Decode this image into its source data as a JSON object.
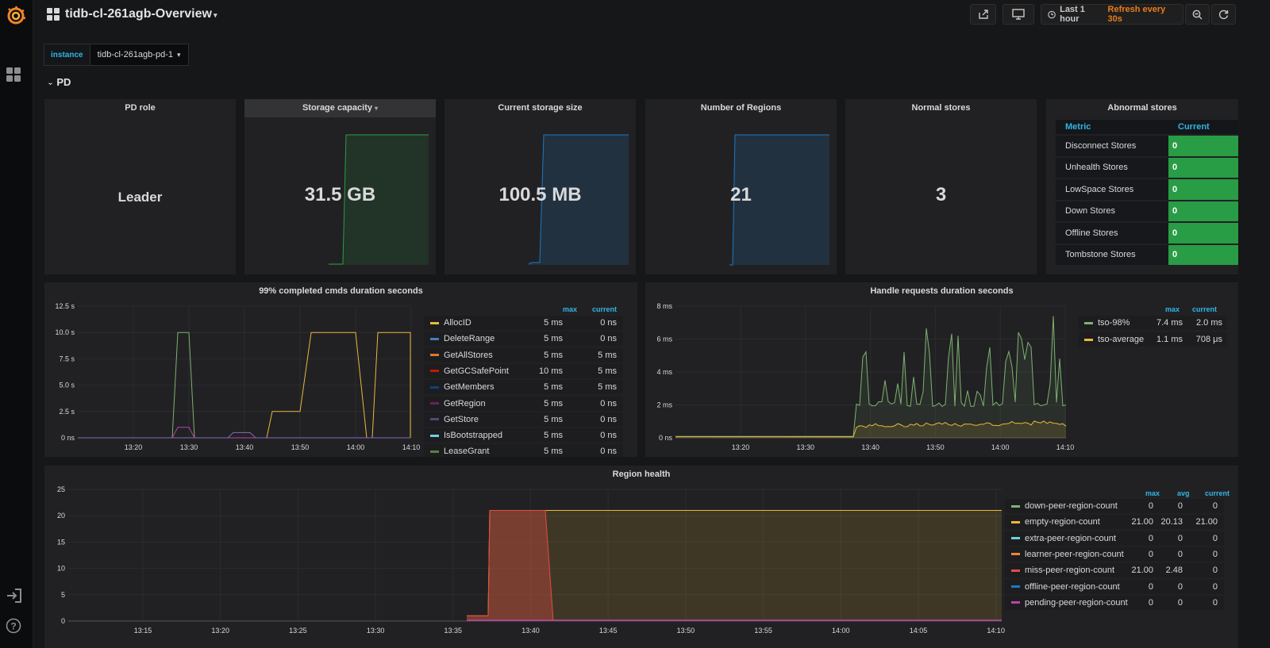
{
  "dashboard": {
    "title": "tidb-cl-261agb-Overview"
  },
  "toolbar": {
    "time_range": "Last 1 hour",
    "refresh": "Refresh every 30s"
  },
  "variable": {
    "label": "instance",
    "value": "tidb-cl-261agb-pd-1"
  },
  "row": {
    "title": "PD"
  },
  "stats": {
    "pd_role": {
      "title": "PD role",
      "value": "Leader"
    },
    "storage_capacity": {
      "title": "Storage capacity",
      "value": "31.5 GB",
      "color": "#299c46"
    },
    "current_storage": {
      "title": "Current storage size",
      "value": "100.5 MB",
      "color": "#1f78c1"
    },
    "regions": {
      "title": "Number of Regions",
      "value": "21",
      "color": "#1f78c1"
    },
    "normal_stores": {
      "title": "Normal stores",
      "value": "3"
    }
  },
  "abnormal": {
    "title": "Abnormal stores",
    "col_metric": "Metric",
    "col_current": "Current",
    "rows": [
      {
        "metric": "Disconnect Stores",
        "current": "0"
      },
      {
        "metric": "Unhealth Stores",
        "current": "0"
      },
      {
        "metric": "LowSpace Stores",
        "current": "0"
      },
      {
        "metric": "Down Stores",
        "current": "0"
      },
      {
        "metric": "Offline Stores",
        "current": "0"
      },
      {
        "metric": "Tombstone Stores",
        "current": "0"
      }
    ]
  },
  "cmds": {
    "title": "99% completed cmds duration seconds",
    "legend_max": "max",
    "legend_current": "current",
    "legend": [
      {
        "name": "AllocID",
        "max": "5 ms",
        "current": "0 ns",
        "color": "#eab839"
      },
      {
        "name": "DeleteRange",
        "max": "5 ms",
        "current": "0 ns",
        "color": "#447ebc"
      },
      {
        "name": "GetAllStores",
        "max": "5 ms",
        "current": "5 ms",
        "color": "#e0752d"
      },
      {
        "name": "GetGCSafePoint",
        "max": "10 ms",
        "current": "5 ms",
        "color": "#bf1b00"
      },
      {
        "name": "GetMembers",
        "max": "5 ms",
        "current": "5 ms",
        "color": "#0a437c"
      },
      {
        "name": "GetRegion",
        "max": "5 ms",
        "current": "0 ns",
        "color": "#6d1f62"
      },
      {
        "name": "GetStore",
        "max": "5 ms",
        "current": "0 ns",
        "color": "#584477"
      },
      {
        "name": "IsBootstrapped",
        "max": "5 ms",
        "current": "0 ns",
        "color": "#6ed0e0"
      },
      {
        "name": "LeaseGrant",
        "max": "5 ms",
        "current": "0 ns",
        "color": "#508642"
      }
    ]
  },
  "handle": {
    "title": "Handle requests duration seconds",
    "legend_max": "max",
    "legend_current": "current",
    "legend": [
      {
        "name": "tso-98%",
        "max": "7.4 ms",
        "current": "2.0 ms",
        "color": "#7eb26d"
      },
      {
        "name": "tso-average",
        "max": "1.1 ms",
        "current": "708 μs",
        "color": "#eab839"
      }
    ]
  },
  "region": {
    "title": "Region health",
    "legend_max": "max",
    "legend_avg": "avg",
    "legend_current": "current",
    "legend": [
      {
        "name": "down-peer-region-count",
        "max": "0",
        "avg": "0",
        "current": "0",
        "color": "#7eb26d"
      },
      {
        "name": "empty-region-count",
        "max": "21.00",
        "avg": "20.13",
        "current": "21.00",
        "color": "#eab839"
      },
      {
        "name": "extra-peer-region-count",
        "max": "0",
        "avg": "0",
        "current": "0",
        "color": "#6ed0e0"
      },
      {
        "name": "learner-peer-region-count",
        "max": "0",
        "avg": "0",
        "current": "0",
        "color": "#ef843c"
      },
      {
        "name": "miss-peer-region-count",
        "max": "21.00",
        "avg": "2.48",
        "current": "0",
        "color": "#e24d42"
      },
      {
        "name": "offline-peer-region-count",
        "max": "0",
        "avg": "0",
        "current": "0",
        "color": "#1f78c1"
      },
      {
        "name": "pending-peer-region-count",
        "max": "0",
        "avg": "0",
        "current": "0",
        "color": "#ba43a9"
      }
    ]
  },
  "chart_data": [
    {
      "type": "line",
      "title": "99% completed cmds duration seconds",
      "ylim": [
        0,
        12.5
      ],
      "yticks": [
        "0 ns",
        "2.5 s",
        "5.0 s",
        "7.5 s",
        "10.0 s",
        "12.5 s"
      ],
      "xticks": [
        "13:20",
        "13:30",
        "13:40",
        "13:50",
        "14:00",
        "14:10"
      ],
      "x_minutes": [
        -8,
        13.2
      ],
      "series": [
        {
          "name": "AllocID",
          "color": "#eab839",
          "points": [
            [
              -8,
              0
            ],
            [
              13.44,
              0
            ],
            [
              13.45,
              2.5
            ],
            [
              13.5,
              2.5
            ],
            [
              13.52,
              10
            ],
            [
              14.0,
              10
            ],
            [
              14.02,
              0
            ],
            [
              14.03,
              0
            ],
            [
              14.04,
              10
            ],
            [
              14.15,
              10
            ],
            [
              14.16,
              0
            ],
            [
              14.18,
              0
            ],
            [
              14.19,
              10
            ],
            [
              14.34,
              10
            ],
            [
              14.35,
              0
            ],
            [
              14.36,
              10
            ],
            [
              14.55,
              10
            ]
          ]
        },
        {
          "name": "LeaseGrant",
          "color": "#7eb26d",
          "points": [
            [
              -8,
              0
            ],
            [
              13.27,
              0
            ],
            [
              13.28,
              10
            ],
            [
              13.3,
              10
            ],
            [
              13.31,
              0
            ],
            [
              14.55,
              0
            ]
          ]
        },
        {
          "name": "GetRegion",
          "color": "#ba43a9",
          "points": [
            [
              -8,
              0
            ],
            [
              13.27,
              0
            ],
            [
              13.28,
              1
            ],
            [
              13.3,
              1
            ],
            [
              13.31,
              0
            ],
            [
              14.55,
              0
            ]
          ]
        },
        {
          "name": "GetStore",
          "color": "#806eb7",
          "points": [
            [
              -8,
              0
            ],
            [
              13.37,
              0
            ],
            [
              13.38,
              0.5
            ],
            [
              13.41,
              0.5
            ],
            [
              13.42,
              0
            ],
            [
              14.55,
              0
            ]
          ]
        }
      ]
    },
    {
      "type": "line",
      "title": "Handle requests duration seconds",
      "ylim": [
        0,
        8
      ],
      "yticks": [
        "0 ns",
        "2 ms",
        "4 ms",
        "6 ms",
        "8 ms"
      ],
      "xticks": [
        "13:20",
        "13:30",
        "13:40",
        "13:50",
        "14:00",
        "14:10"
      ],
      "series": [
        {
          "name": "tso-98%",
          "color": "#7eb26d",
          "max": 7.4,
          "current": 2.0
        },
        {
          "name": "tso-average",
          "color": "#eab839",
          "max": 1.1,
          "current": 0.708
        }
      ]
    },
    {
      "type": "area",
      "title": "Region health",
      "ylim": [
        0,
        25
      ],
      "yticks": [
        "0",
        "5",
        "10",
        "15",
        "20",
        "25"
      ],
      "xticks": [
        "13:15",
        "13:20",
        "13:25",
        "13:30",
        "13:35",
        "13:40",
        "13:45",
        "13:50",
        "13:55",
        "14:00",
        "14:05",
        "14:10"
      ],
      "series": [
        {
          "name": "empty-region-count",
          "color": "#eab839"
        },
        {
          "name": "miss-peer-region-count",
          "color": "#e24d42"
        },
        {
          "name": "pending-peer-region-count",
          "color": "#ba43a9"
        }
      ]
    }
  ]
}
